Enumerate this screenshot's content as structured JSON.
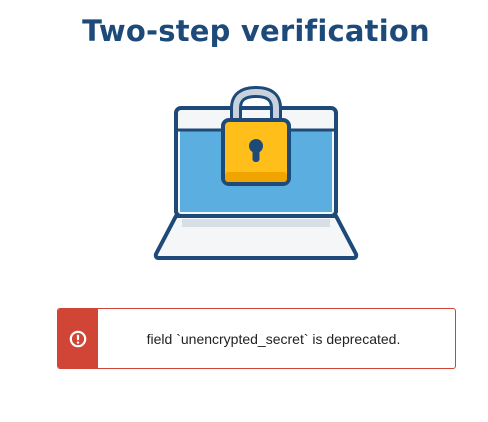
{
  "page": {
    "title": "Two-step verification"
  },
  "illustration": {
    "icon": "laptop-lock-icon",
    "colors": {
      "outline": "#1e4a7a",
      "screen": "#5aaee0",
      "bezel": "#f4f6f8",
      "lock_body": "#ffbe1a",
      "lock_shackle": "#c8d2dc"
    }
  },
  "alert": {
    "icon": "exclamation-circle-icon",
    "message": "field `unencrypted_secret` is deprecated.",
    "color": "#d14536"
  }
}
